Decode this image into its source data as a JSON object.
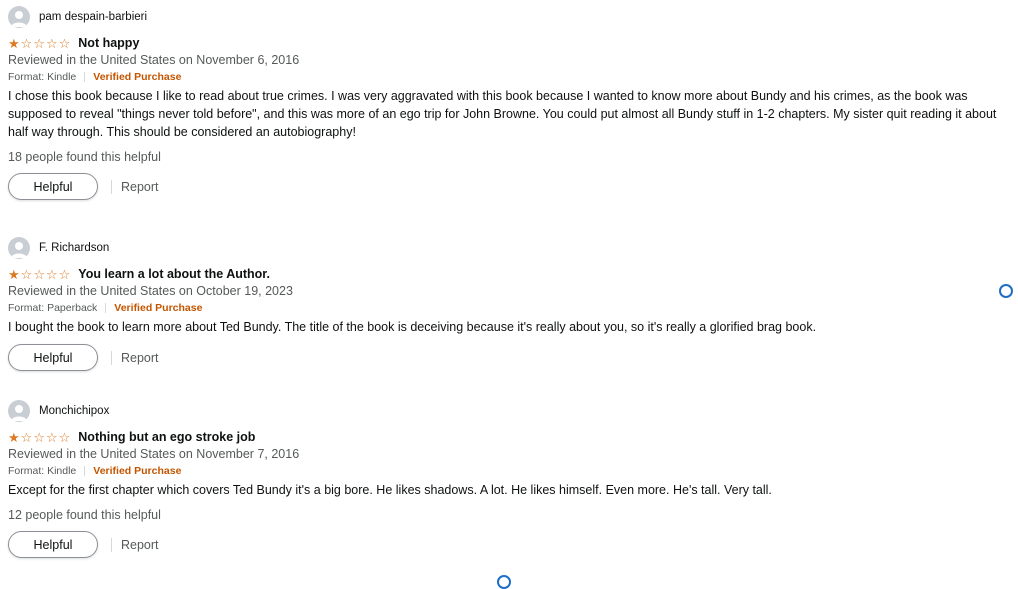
{
  "reviews": [
    {
      "author": "pam despain-barbieri",
      "rating": 1,
      "title": "Not happy",
      "date": "Reviewed in the United States on November 6, 2016",
      "format": "Format: Kindle",
      "verified": "Verified Purchase",
      "body": "I chose this book because I like to read about true crimes. I was very aggravated with this book because I wanted to know more about Bundy and his crimes, as the book was supposed to reveal \"things never told before\", and this was more of an ego trip for John Browne. You could put almost all Bundy stuff in 1-2 chapters. My sister quit reading it about half way through. This should be considered an autobiography!",
      "helpful_count": "18 people found this helpful",
      "helpful_label": "Helpful",
      "report_label": "Report"
    },
    {
      "author": "F. Richardson",
      "rating": 1,
      "title": "You learn a lot about the Author.",
      "date": "Reviewed in the United States on October 19, 2023",
      "format": "Format: Paperback",
      "verified": "Verified Purchase",
      "body": "I bought the book to learn more about Ted Bundy. The title of the book is deceiving because it's really about you, so it's really a glorified brag book.",
      "helpful_count": "",
      "helpful_label": "Helpful",
      "report_label": "Report"
    },
    {
      "author": "Monchichipox",
      "rating": 1,
      "title": "Nothing but an ego stroke job",
      "date": "Reviewed in the United States on November 7, 2016",
      "format": "Format: Kindle",
      "verified": "Verified Purchase",
      "body": "Except for the first chapter which covers Ted Bundy it's a big bore. He likes shadows. A lot. He likes himself. Even more. He's tall. Very tall.",
      "helpful_count": "12 people found this helpful",
      "helpful_label": "Helpful",
      "report_label": "Report"
    }
  ],
  "colors": {
    "star": "#de7921",
    "verified": "#c45500",
    "secondary_text": "#565959",
    "cursor": "#1e6ec8"
  }
}
